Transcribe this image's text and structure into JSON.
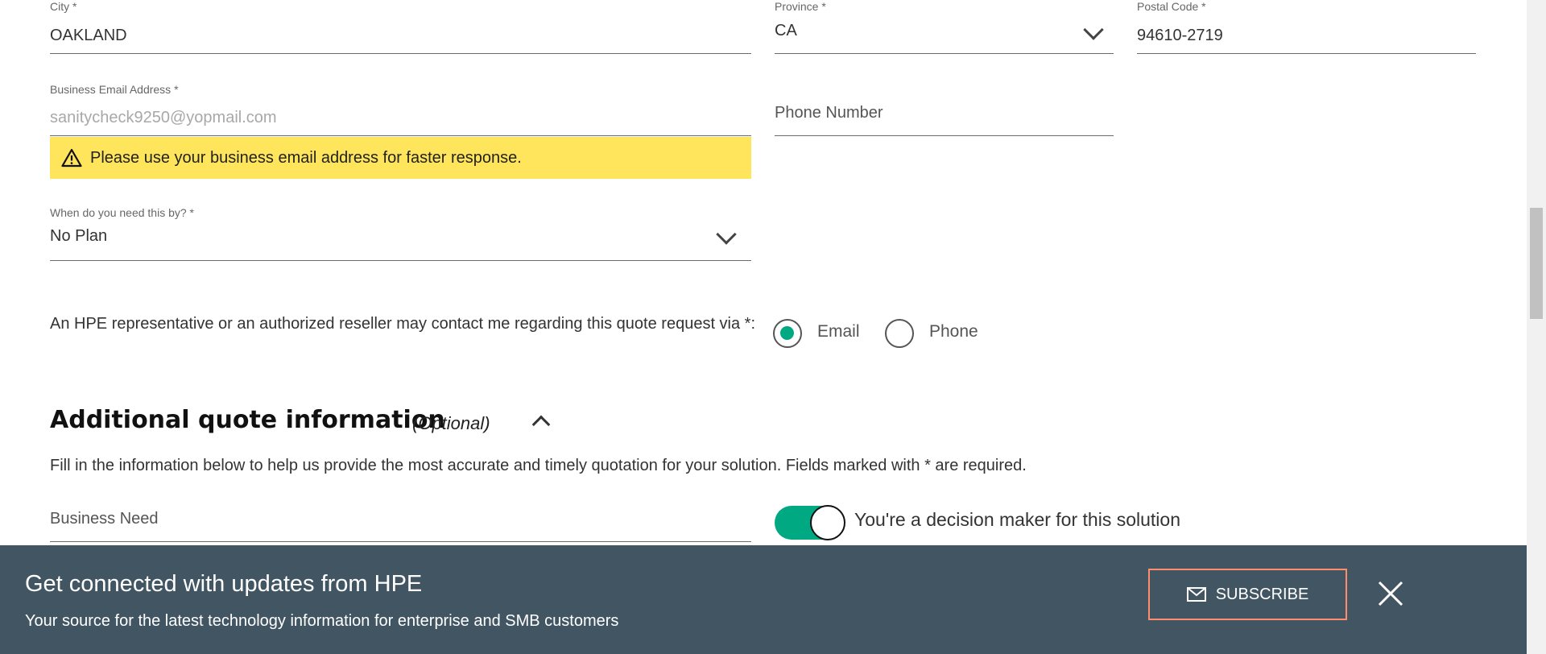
{
  "address": {
    "city": {
      "label": "City *",
      "value": "OAKLAND"
    },
    "province": {
      "label": "Province *",
      "value": "CA"
    },
    "postal": {
      "label": "Postal Code *",
      "value": "94610-2719"
    }
  },
  "email": {
    "label": "Business Email Address *",
    "value": "sanitycheck9250@yopmail.com",
    "warning": "Please use your business email address for faster response."
  },
  "phone": {
    "placeholder": "Phone Number"
  },
  "timeline": {
    "label": "When do you need this by? *",
    "value": "No Plan"
  },
  "contact": {
    "prompt": "An HPE representative or an authorized reseller may contact me regarding this quote request via *:",
    "options": [
      {
        "label": "Email",
        "selected": true
      },
      {
        "label": "Phone",
        "selected": false
      }
    ]
  },
  "additional": {
    "title": "Additional quote information",
    "optional": "(Optional)",
    "description": "Fill in the information below to help us provide the most accurate and timely quotation for your solution. Fields marked with * are required.",
    "business_need_placeholder": "Business Need",
    "decision_maker_label": "You're a decision maker for this solution",
    "decision_maker_on": true
  },
  "banner": {
    "title": "Get connected with updates from HPE",
    "subtitle": "Your source for the latest technology information for enterprise and SMB customers",
    "subscribe_label": "SUBSCRIBE"
  },
  "colors": {
    "accent": "#01a982",
    "warning_bg": "#ffe55c",
    "banner_bg": "#425563",
    "subscribe_border": "#ff8d6d"
  }
}
